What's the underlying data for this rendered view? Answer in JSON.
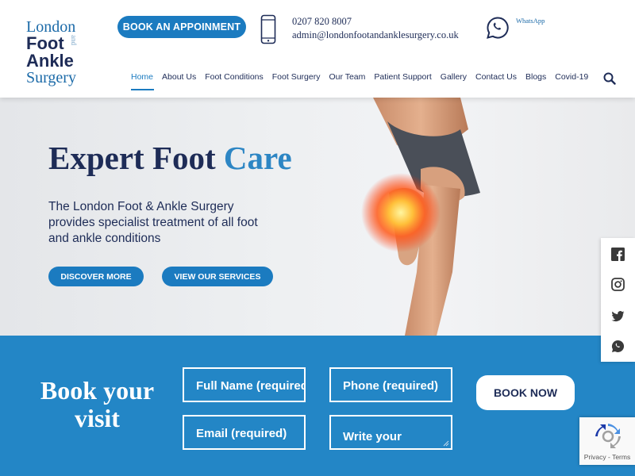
{
  "logo": {
    "line1": "London",
    "line2": "Foot",
    "and": "and",
    "line3": "Ankle",
    "line4": "Surgery"
  },
  "header": {
    "book_button": "BOOK AN APPOINMENT",
    "phone": "0207 820 8007",
    "email": "admin@londonfootandanklesurgery.co.uk",
    "whatsapp_label": "WhatsApp",
    "icons": {
      "phone": "mobile-phone-icon",
      "whatsapp": "whatsapp-icon",
      "search": "search-icon"
    }
  },
  "nav": {
    "items": [
      {
        "label": "Home",
        "active": true
      },
      {
        "label": "About Us"
      },
      {
        "label": "Foot Conditions"
      },
      {
        "label": "Foot Surgery"
      },
      {
        "label": "Our Team"
      },
      {
        "label": "Patient Support"
      },
      {
        "label": "Gallery"
      },
      {
        "label": "Contact Us"
      },
      {
        "label": "Blogs"
      },
      {
        "label": "Covid-19"
      }
    ]
  },
  "hero": {
    "title_main": "Expert Foot ",
    "title_accent": "Care",
    "description": "The London Foot & Ankle Surgery provides specialist treatment of all foot and ankle conditions",
    "discover_button": "DISCOVER MORE",
    "services_button": "VIEW OUR SERVICES"
  },
  "social": {
    "icons": [
      "facebook-icon",
      "instagram-icon",
      "twitter-icon",
      "whatsapp-icon"
    ]
  },
  "booking": {
    "title": "Book your visit",
    "fields": {
      "name_placeholder": "Full Name  (required)",
      "phone_placeholder": "Phone (required)",
      "email_placeholder": "Email (required)",
      "message_placeholder": "Write your message"
    },
    "submit": "BOOK NOW"
  },
  "recaptcha": {
    "text": "Privacy - Terms"
  },
  "colors": {
    "brand_blue": "#1b7bc0",
    "navy": "#1e2c57",
    "booking_bg": "#2386c6"
  }
}
